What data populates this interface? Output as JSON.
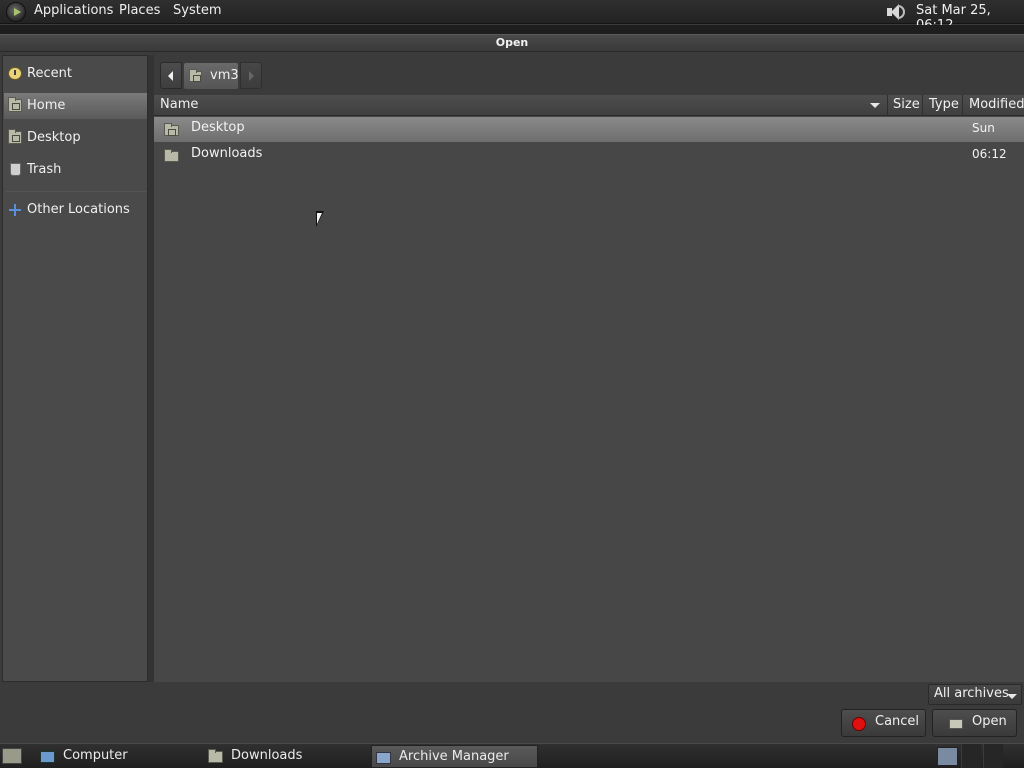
{
  "top_panel": {
    "menus": [
      "Applications",
      "Places",
      "System"
    ],
    "clock": "Sat Mar 25, 06:12"
  },
  "dialog": {
    "title": "Open"
  },
  "sidebar": {
    "items": [
      {
        "label": "Recent",
        "icon": "clock-icon"
      },
      {
        "label": "Home",
        "icon": "home-folder-icon",
        "selected": true
      },
      {
        "label": "Desktop",
        "icon": "desktop-folder-icon"
      },
      {
        "label": "Trash",
        "icon": "trash-icon"
      },
      {
        "label": "Other Locations",
        "icon": "plus-icon"
      }
    ]
  },
  "path_bar": {
    "current": "vm3"
  },
  "file_list": {
    "columns": [
      "Name",
      "Size",
      "Type",
      "Modified"
    ],
    "rows": [
      {
        "name": "Desktop",
        "size": "",
        "type": "",
        "modified": "Sun",
        "selected": true
      },
      {
        "name": "Downloads",
        "size": "",
        "type": "",
        "modified": "06:12",
        "selected": false
      }
    ]
  },
  "filter": {
    "value": "All archives"
  },
  "buttons": {
    "cancel": "Cancel",
    "open": "Open"
  },
  "taskbar": {
    "tasks": [
      {
        "label": "Computer",
        "icon": "computer-icon"
      },
      {
        "label": "Downloads",
        "icon": "folder-icon"
      },
      {
        "label": "Archive Manager",
        "icon": "archive-manager-icon",
        "active": true
      }
    ]
  },
  "colors": {
    "panel": "#2f2f2f",
    "window": "#3b3b3b",
    "selection": "#7a7a7a",
    "cancel_icon": "#e01010"
  }
}
